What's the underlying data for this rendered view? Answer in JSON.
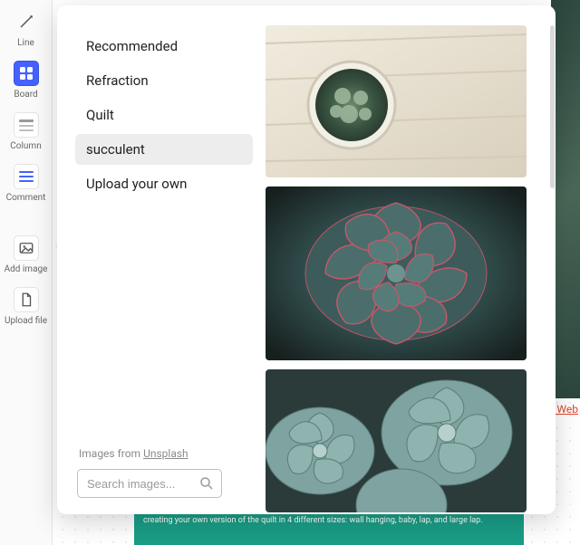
{
  "toolbar": {
    "items": [
      {
        "label": "Line"
      },
      {
        "label": "Board"
      },
      {
        "label": "Column"
      },
      {
        "label": "Comment"
      },
      {
        "label": "Add image"
      },
      {
        "label": "Upload file"
      }
    ]
  },
  "modal": {
    "categories": [
      {
        "label": "Recommended"
      },
      {
        "label": "Refraction"
      },
      {
        "label": "Quilt"
      },
      {
        "label": "succulent",
        "selected": true
      },
      {
        "label": "Upload your own"
      }
    ],
    "attribution_prefix": "Images from ",
    "attribution_source": "Unsplash",
    "search_placeholder": "Search images..."
  },
  "background": {
    "green_card_text": "creating your own version of the quilt in 4 different sizes: wall hanging, baby, lap, and large lap.",
    "side_link_text": "t Web"
  }
}
